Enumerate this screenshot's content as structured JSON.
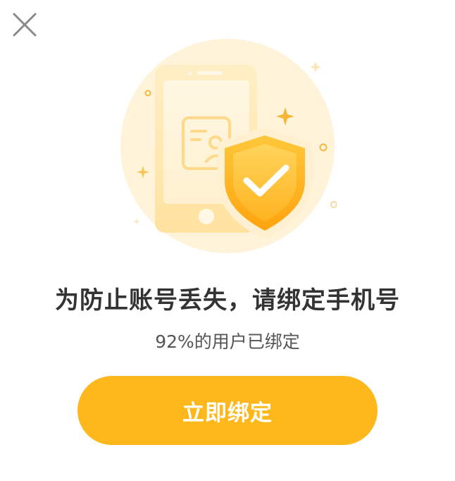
{
  "header": {
    "close_icon": "close-icon"
  },
  "illustration": {
    "icon": "phone-shield-check-illustration",
    "colors": {
      "circle": "#FFF4DA",
      "phone": "#FFE9B3",
      "shield": "#FFB81C",
      "check": "#ffffff"
    }
  },
  "main": {
    "headline": "为防止账号丢失，请绑定手机号",
    "subline": "92%的用户已绑定"
  },
  "actions": {
    "bind_label": "立即绑定"
  },
  "theme": {
    "accent": "#FFB81C",
    "text": "#333333"
  }
}
